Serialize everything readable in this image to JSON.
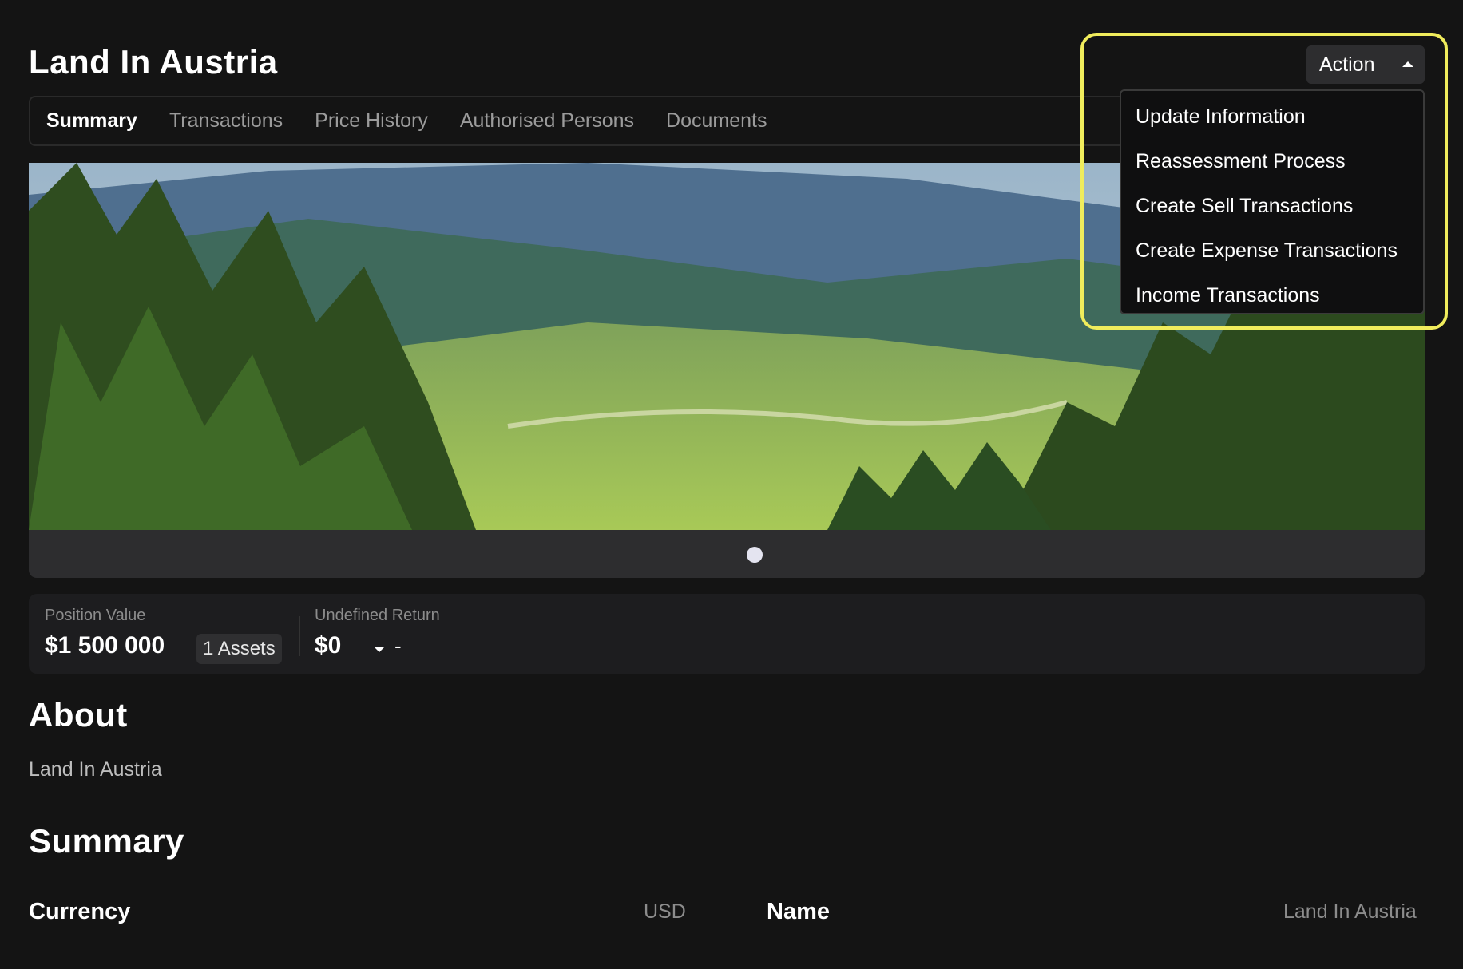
{
  "page": {
    "title": "Land In Austria"
  },
  "tabs": [
    {
      "label": "Summary",
      "active": true
    },
    {
      "label": "Transactions",
      "active": false
    },
    {
      "label": "Price History",
      "active": false
    },
    {
      "label": "Authorised Persons",
      "active": false
    },
    {
      "label": "Documents",
      "active": false
    }
  ],
  "action": {
    "label": "Action",
    "menu": [
      "Update Information",
      "Reassessment Process",
      "Create Sell Transactions",
      "Create Expense Transactions",
      "Income Transactions"
    ]
  },
  "carousel": {
    "slides": 1,
    "active_index": 0
  },
  "stats": {
    "position_label": "Position Value",
    "position_value": "$1 500 000",
    "assets_badge": "1 Assets",
    "return_label": "Undefined Return",
    "return_value": "$0",
    "return_change": "-"
  },
  "about": {
    "heading": "About",
    "text": "Land In Austria"
  },
  "summary": {
    "heading": "Summary",
    "currency_label": "Currency",
    "currency_value": "USD",
    "name_label": "Name",
    "name_value": "Land In Austria"
  },
  "colors": {
    "background": "#141414",
    "highlight": "#f0ec5c",
    "panel": "#1d1d1f"
  }
}
